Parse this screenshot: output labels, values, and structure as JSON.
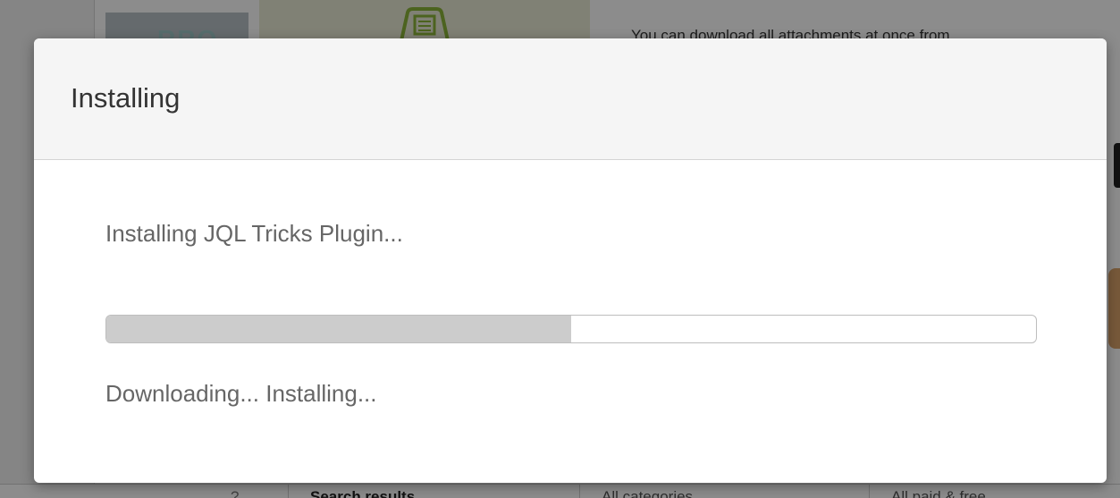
{
  "background": {
    "thumb_text": "RRO",
    "description_line": "You can download all attachments at once from",
    "footer_help": "?",
    "footer_tabs": [
      "Search results",
      "All categories",
      "All paid & free"
    ]
  },
  "dialog": {
    "title": "Installing",
    "status": "Installing JQL Tricks Plugin...",
    "progress_fraction": 0.5,
    "phase": "Downloading... Installing..."
  },
  "colors": {
    "progress_fill": "#cccccc",
    "progress_border": "#bdbdbd",
    "header_bg": "#f5f5f5"
  }
}
